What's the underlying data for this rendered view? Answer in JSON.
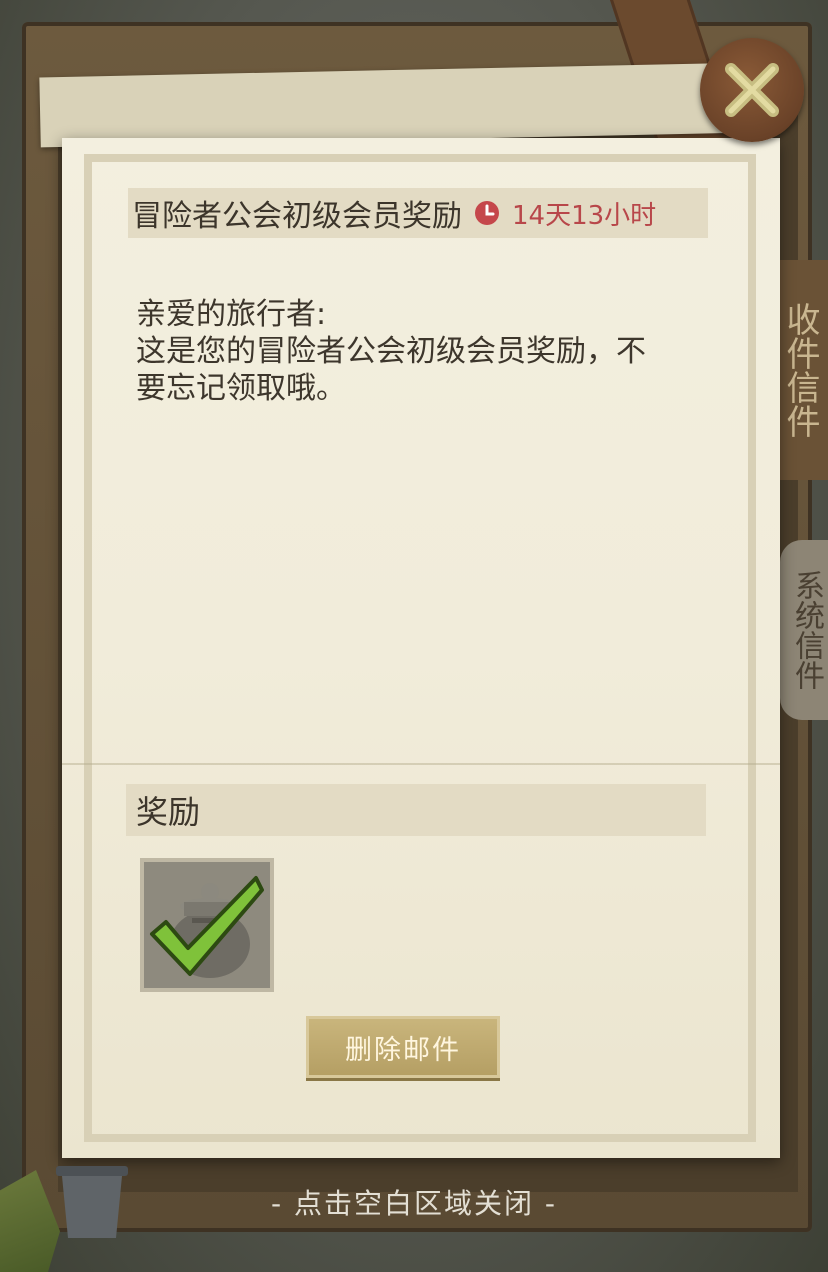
{
  "mail": {
    "title": "冒险者公会初级会员奖励",
    "time_remaining": "14天13小时",
    "greeting": "亲爱的旅行者:",
    "body_line1": "这是您的冒险者公会初级会员奖励，不",
    "body_line2": "要忘记领取哦。"
  },
  "reward": {
    "title": "奖励",
    "item_icon": "jar-icon",
    "claimed": true
  },
  "buttons": {
    "delete_label": "删除邮件",
    "close_icon": "close-x-icon"
  },
  "side_tabs": {
    "tab1": "收件信件",
    "tab2": "系统信件"
  },
  "hint": "- 点击空白区域关闭 -",
  "colors": {
    "time_red": "#b8474a",
    "check_green": "#7fc23a",
    "button_gold": "#c9b57c"
  }
}
